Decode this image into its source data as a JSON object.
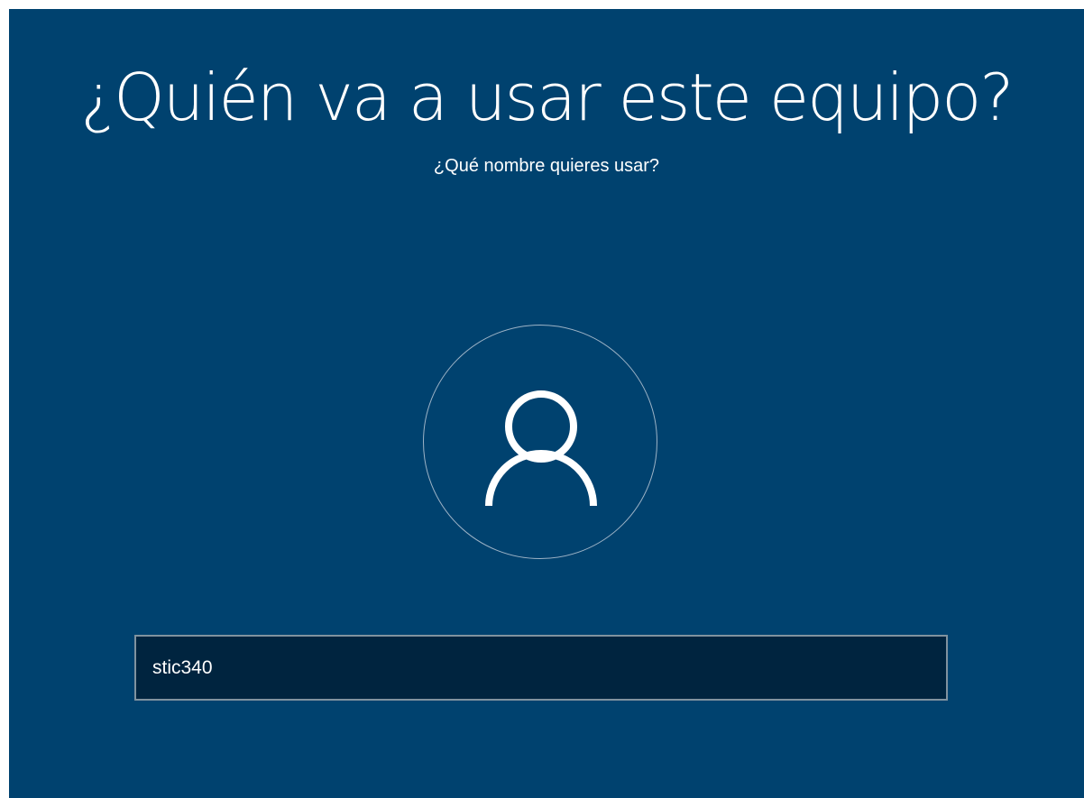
{
  "screen": {
    "title": "¿Quién va a usar este equipo?",
    "subtitle": "¿Qué nombre quieres usar?"
  },
  "avatar": {
    "icon": "user-icon"
  },
  "name_field": {
    "value": "stic340"
  },
  "colors": {
    "background": "#00426f",
    "input_background": "#00243f",
    "input_border": "#80929f",
    "text": "#ffffff"
  }
}
